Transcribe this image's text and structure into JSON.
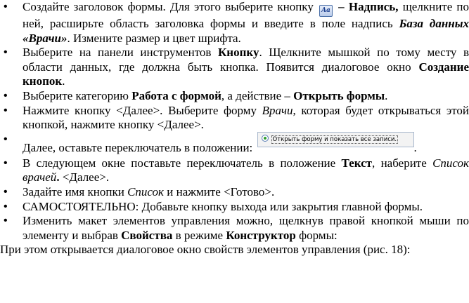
{
  "items": [
    {
      "p1": "Создайте заголовок формы. Для этого выберите кнопку",
      "icon_text": "Aa",
      "p2": "–",
      "b1": "Надпись,",
      "p3": "щелкните по ней, расширьте область заголовка формы и введите в поле надпись",
      "bi1": "База данных «Врачи»",
      "p4": ". Измените размер и цвет шрифта."
    },
    {
      "p1": "Выберите на панели инструментов",
      "b1": "Кнопку",
      "p2": ". Щелкните мышкой по тому месту в области данных, где должна быть кнопка. Появится диалоговое окно",
      "b2": "Создание кнопок",
      "p3": "."
    },
    {
      "p1": "Выберите категорию",
      "b1": "Работа с формой",
      "p2": ", а действие –",
      "b2": "Открыть формы",
      "p3": "."
    },
    {
      "p1": "Нажмите кнопку <Далее>. Выберите форму",
      "i1": "Врачи",
      "p2": ", которая будет открываться этой кнопкой, нажмите кнопку <Далее>."
    },
    {
      "p1": "Далее, оставьте переключатель в положении:",
      "radio_label": "Открыть форму и показать все записи.",
      "p2": "."
    },
    {
      "p1": "В следующем окне поставьте переключатель в положение",
      "b1": "Текст",
      "p2": ", наберите",
      "i1": "Список врачей",
      "b2": ".",
      "p3": " <Далее>."
    },
    {
      "p1": "Задайте имя кнопки",
      "i1": "Список",
      "p2": "и нажмите <Готово>."
    },
    {
      "p1": "САМОСТОЯТЕЛЬНО: Добавьте кнопку выхода или закрытия главной формы."
    },
    {
      "p1": "Изменить макет элементов управления можно, щелкнув правой кнопкой мыши по элементу и выбрав",
      "b1": "Свойства",
      "p2": "в режиме",
      "b2": "Конструктор",
      "p3": "формы:"
    }
  ],
  "final_paragraph": "При этом открывается диалоговое окно свойств элементов управления (рис. 18):",
  "colors": {
    "icon_blue": "#1b3f8f",
    "radio_green": "#2f9e2f"
  },
  "icons": {
    "caption_button": "caption-label-icon",
    "radio": "radio-button-icon"
  }
}
